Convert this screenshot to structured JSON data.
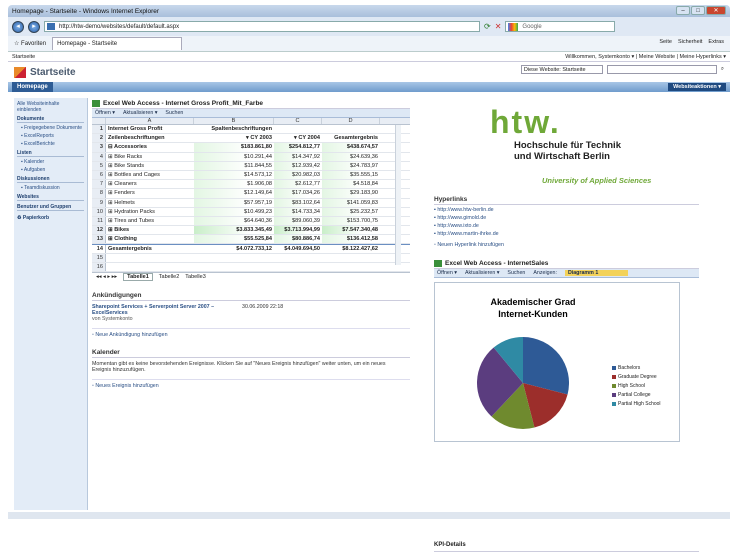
{
  "browser": {
    "title": "Homepage - Startseite - Windows Internet Explorer",
    "url": "http://htw-demo/websites/default/default.aspx",
    "search_engine": "Google",
    "favorites": "Favoriten",
    "tab": "Homepage - Startseite",
    "tools": [
      "Seite",
      "Sicherheit",
      "Extras"
    ]
  },
  "site": {
    "breadcrumb": "Startseite",
    "user_links": "Willkommen, Systemkonto ▾ | Meine Website | Meine Hyperlinks ▾",
    "title": "Startseite",
    "search_scope": "Diese Website: Startseite",
    "home_tab": "Homepage",
    "site_actions": "Websiteaktionen ▾"
  },
  "leftnav": {
    "show_all": "Alle Websiteinhalte einblenden",
    "sections": [
      {
        "title": "Dokumente",
        "items": [
          "Freigegebene Dokumente",
          "ExcelReports",
          "ExcelBerichte"
        ]
      },
      {
        "title": "Listen",
        "items": [
          "Kalender",
          "Aufgaben"
        ]
      },
      {
        "title": "Diskussionen",
        "items": [
          "Teamdiskussion"
        ]
      },
      {
        "title": "Websites",
        "items": []
      },
      {
        "title": "Benutzer und Gruppen",
        "items": []
      }
    ],
    "recycle": "Papierkorb"
  },
  "excel1": {
    "title": "Excel Web Access - Internet Gross Profit_Mit_Farbe",
    "toolbar": [
      "Öffnen ▾",
      "Aktualisieren ▾",
      "Suchen"
    ],
    "columns": [
      "A",
      "B",
      "C",
      "D"
    ],
    "rows": [
      [
        "1",
        "Internet Gross Profit",
        "Spaltenbeschriftungen",
        "",
        ""
      ],
      [
        "2",
        "Zeilenbeschriftungen",
        "▾ CY 2003",
        "▾ CY 2004",
        "Gesamtergebnis"
      ],
      [
        "3",
        "⊟ Accessories",
        "$183.861,80",
        "$254.812,77",
        "$438.674,57"
      ],
      [
        "4",
        "⊞ Bike Racks",
        "$10.291,44",
        "$14.347,92",
        "$24.639,36"
      ],
      [
        "5",
        "⊞ Bike Stands",
        "$11.844,55",
        "$12.939,42",
        "$24.783,97"
      ],
      [
        "6",
        "⊞ Bottles and Cages",
        "$14.573,12",
        "$20.982,03",
        "$35.555,15"
      ],
      [
        "7",
        "⊞ Cleaners",
        "$1.906,08",
        "$2.612,77",
        "$4.518,84"
      ],
      [
        "8",
        "⊞ Fenders",
        "$12.149,64",
        "$17.034,26",
        "$29.183,90"
      ],
      [
        "9",
        "⊞ Helmets",
        "$57.957,19",
        "$83.102,64",
        "$141.059,83"
      ],
      [
        "10",
        "⊞ Hydration Packs",
        "$10.499,23",
        "$14.733,34",
        "$25.232,57"
      ],
      [
        "11",
        "⊞ Tires and Tubes",
        "$64.640,36",
        "$89.060,39",
        "$153.700,75"
      ],
      [
        "12",
        "⊞ Bikes",
        "$3.833.345,49",
        "$3.713.994,99",
        "$7.547.340,48"
      ],
      [
        "13",
        "⊞ Clothing",
        "$55.525,84",
        "$80.886,74",
        "$136.412,58"
      ],
      [
        "14",
        "Gesamtergebnis",
        "$4.072.733,12",
        "$4.049.694,50",
        "$8.122.427,62"
      ],
      [
        "15",
        "",
        "",
        "",
        ""
      ],
      [
        "16",
        "",
        "",
        "",
        ""
      ]
    ],
    "sheets": [
      "Tabelle1",
      "Tabelle2",
      "Tabelle3"
    ]
  },
  "announcements": {
    "title": "Ankündigungen",
    "item_title": "Sharepoint Services + Serverpoint Server 2007 – ExcelServices",
    "item_by": "von Systemkonto",
    "item_date": "30.06.2009 22:18",
    "add": "Neue Ankündigung hinzufügen"
  },
  "calendar": {
    "title": "Kalender",
    "text": "Momentan gibt es keine bevorstehenden Ereignisse. Klicken Sie auf \"Neues Ereignis hinzufügen\" weiter unten, um ein neues Ereignis hinzuzufügen.",
    "add": "Neues Ereignis hinzufügen"
  },
  "htw": {
    "logo": "htw.",
    "line1": "Hochschule für Technik",
    "line2": "und Wirtschaft Berlin",
    "line3": "University of Applied Sciences"
  },
  "hyperlinks": {
    "title": "Hyperlinks",
    "items": [
      "http://www.htw-berlin.de",
      "http://www.gimold.de",
      "http://www.ixto.de",
      "http://www.martin-ihrke.de"
    ],
    "add": "Neuen Hyperlink hinzufügen"
  },
  "excel2": {
    "title": "Excel Web Access - InternetSales",
    "toolbar": [
      "Öffnen ▾",
      "Aktualisieren ▾",
      "Suchen",
      "Anzeigen:"
    ],
    "view": "Diagramm 1"
  },
  "chart_data": {
    "type": "pie",
    "title": "Akademischer Grad Internet-Kunden",
    "categories": [
      "Bachelors",
      "Graduate Degree",
      "High School",
      "Partial College",
      "Partial High School"
    ],
    "values": [
      29,
      17,
      16,
      27,
      11
    ],
    "colors": [
      "#2e5a96",
      "#9c2e2b",
      "#6f8a2e",
      "#5b3d7f",
      "#2f8aa4"
    ]
  },
  "kpi": {
    "title": "KPI-Details"
  }
}
